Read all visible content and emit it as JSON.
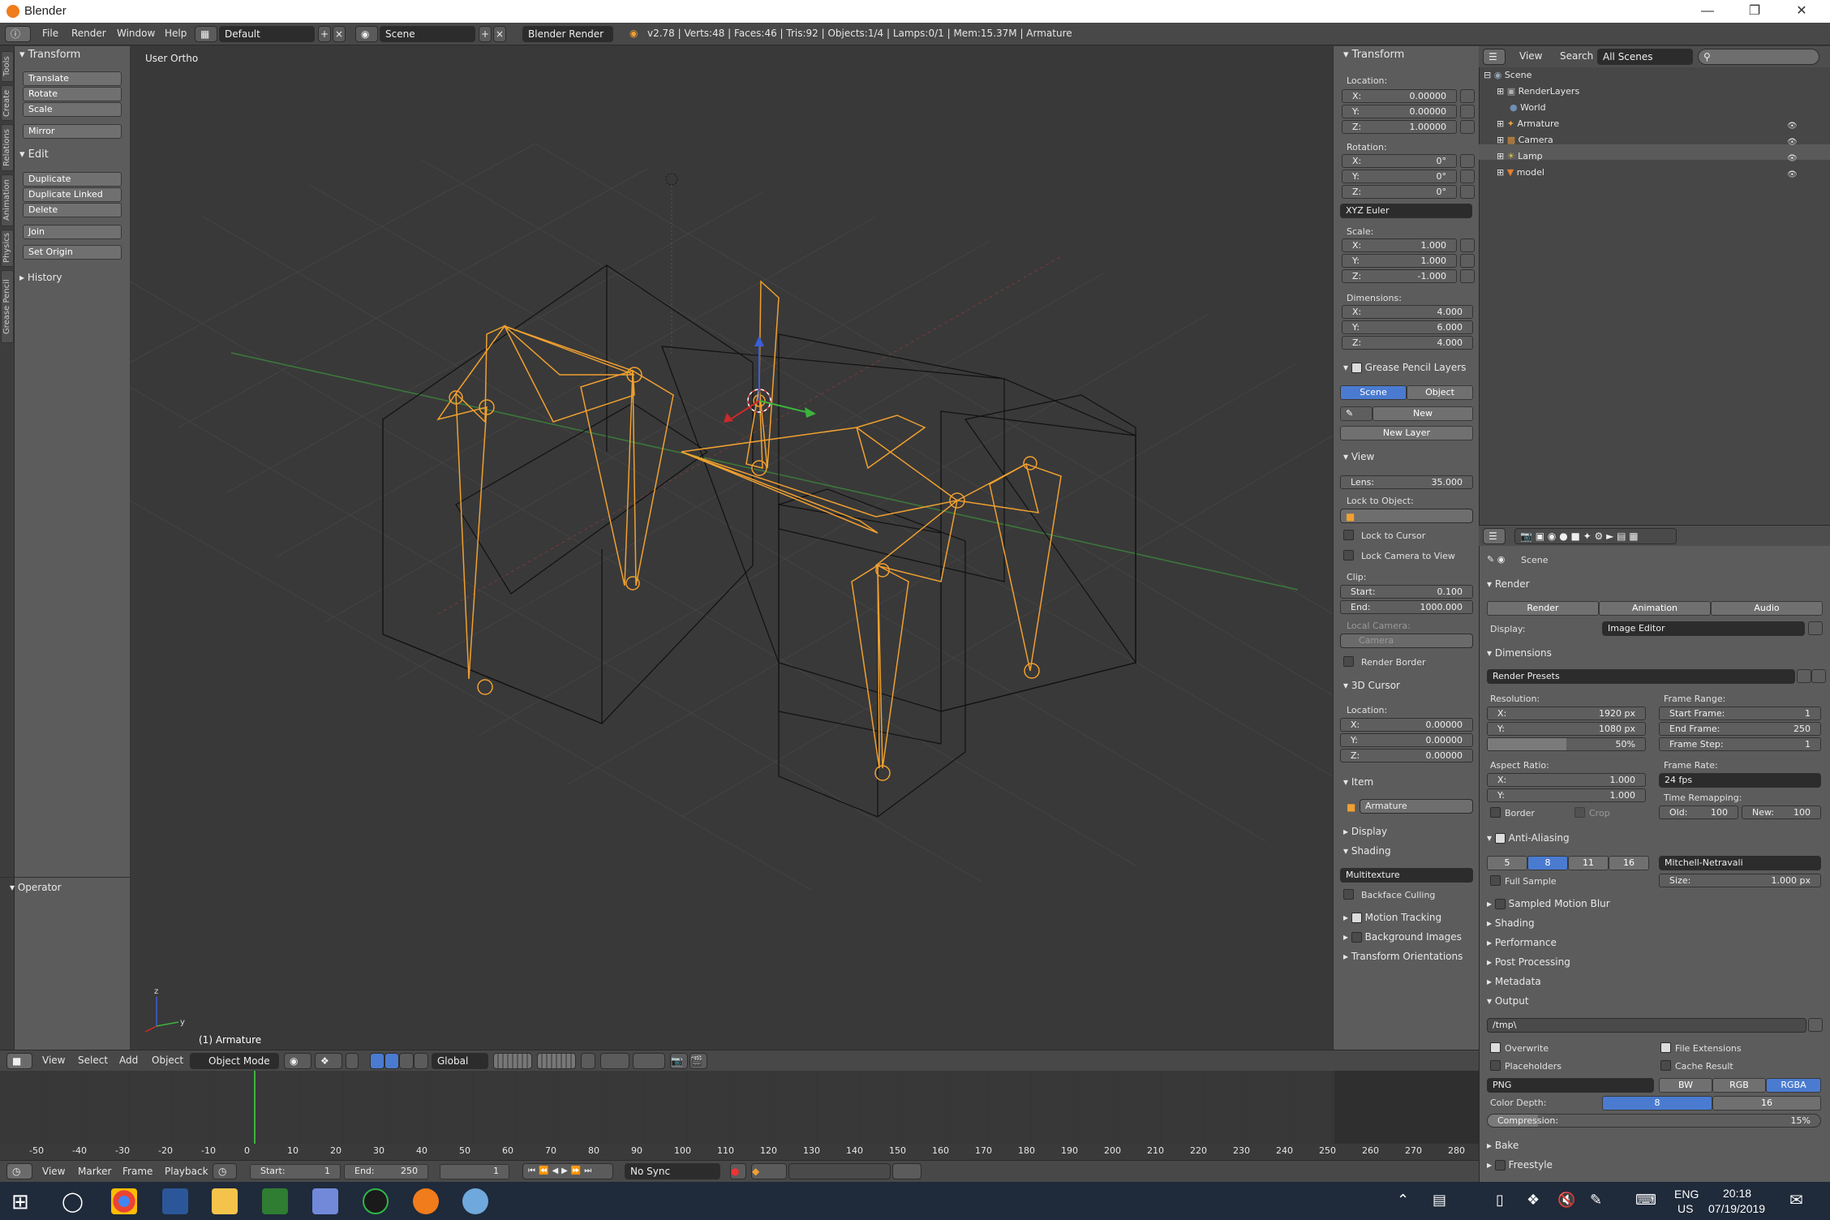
{
  "window": {
    "title": "Blender"
  },
  "info_header": {
    "menus": [
      "File",
      "Render",
      "Window",
      "Help"
    ],
    "layout": "Default",
    "scene": "Scene",
    "engine": "Blender Render",
    "stats": "v2.78 | Verts:48 | Faces:46 | Tris:92 | Objects:1/4 | Lamps:0/1 | Mem:15.37M | Armature"
  },
  "tool_tabs": [
    "Tools",
    "Create",
    "Relations",
    "Animation",
    "Physics",
    "Grease Pencil"
  ],
  "tool_shelf": {
    "transform_title": "Transform",
    "transform_buttons": [
      "Translate",
      "Rotate",
      "Scale"
    ],
    "mirror": "Mirror",
    "edit_title": "Edit",
    "edit_buttons": [
      "Duplicate",
      "Duplicate Linked",
      "Delete"
    ],
    "join": "Join",
    "set_origin": "Set Origin",
    "history": "History",
    "operator": "Operator"
  },
  "viewport": {
    "view_name": "User Ortho",
    "object_label": "(1) Armature"
  },
  "n_panel": {
    "transform": "Transform",
    "location_label": "Location:",
    "location": [
      {
        "k": "X:",
        "v": "0.00000"
      },
      {
        "k": "Y:",
        "v": "0.00000"
      },
      {
        "k": "Z:",
        "v": "1.00000"
      }
    ],
    "rotation_label": "Rotation:",
    "rotation": [
      {
        "k": "X:",
        "v": "0°"
      },
      {
        "k": "Y:",
        "v": "0°"
      },
      {
        "k": "Z:",
        "v": "0°"
      }
    ],
    "rotation_mode": "XYZ Euler",
    "scale_label": "Scale:",
    "scale": [
      {
        "k": "X:",
        "v": "1.000"
      },
      {
        "k": "Y:",
        "v": "1.000"
      },
      {
        "k": "Z:",
        "v": "-1.000"
      }
    ],
    "dimensions_label": "Dimensions:",
    "dimensions": [
      {
        "k": "X:",
        "v": "4.000"
      },
      {
        "k": "Y:",
        "v": "6.000"
      },
      {
        "k": "Z:",
        "v": "4.000"
      }
    ],
    "grease_pencil": "Grease Pencil Layers",
    "gp_scene": "Scene",
    "gp_object": "Object",
    "gp_new": "New",
    "gp_new_layer": "New Layer",
    "view": "View",
    "lens_k": "Lens:",
    "lens_v": "35.000",
    "lock_to_object": "Lock to Object:",
    "lock_to_cursor": "Lock to Cursor",
    "lock_camera": "Lock Camera to View",
    "clip": "Clip:",
    "clip_start_k": "Start:",
    "clip_start_v": "0.100",
    "clip_end_k": "End:",
    "clip_end_v": "1000.000",
    "local_camera": "Local Camera:",
    "camera": "Camera",
    "render_border": "Render Border",
    "cursor": "3D Cursor",
    "cursor_location": "Location:",
    "cursor_loc": [
      {
        "k": "X:",
        "v": "0.00000"
      },
      {
        "k": "Y:",
        "v": "0.00000"
      },
      {
        "k": "Z:",
        "v": "0.00000"
      }
    ],
    "item": "Item",
    "item_name": "Armature",
    "display": "Display",
    "shading": "Shading",
    "shading_mode": "Multitexture",
    "backface": "Backface Culling",
    "motion_tracking": "Motion Tracking",
    "background_images": "Background Images",
    "transform_orientations": "Transform Orientations"
  },
  "outliner": {
    "view": "View",
    "search": "Search",
    "scenes": "All Scenes",
    "items": [
      {
        "label": "Scene",
        "color": "#9aa6b8"
      },
      {
        "label": "RenderLayers",
        "color": "#b0b0b0"
      },
      {
        "label": "World",
        "color": "#6f8fb5"
      },
      {
        "label": "Armature",
        "color": "#e8a040"
      },
      {
        "label": "Camera",
        "color": "#d88f3b"
      },
      {
        "label": "Lamp",
        "color": "#d6c04a"
      },
      {
        "label": "model",
        "color": "#e27c2f"
      }
    ]
  },
  "properties": {
    "scene": "Scene",
    "render": "Render",
    "render_btn": "Render",
    "animation_btn": "Animation",
    "audio_btn": "Audio",
    "display_k": "Display:",
    "display_v": "Image Editor",
    "dimensions": "Dimensions",
    "render_presets": "Render Presets",
    "resolution": "Resolution:",
    "res_x_k": "X:",
    "res_x_v": "1920 px",
    "res_y_k": "Y:",
    "res_y_v": "1080 px",
    "res_pct": "50%",
    "res_pct_value": 0.5,
    "frame_range": "Frame Range:",
    "start_frame_k": "Start Frame:",
    "start_frame_v": "1",
    "end_frame_k": "End Frame:",
    "end_frame_v": "250",
    "frame_step_k": "Frame Step:",
    "frame_step_v": "1",
    "aspect": "Aspect Ratio:",
    "asp_x_k": "X:",
    "asp_x_v": "1.000",
    "asp_y_k": "Y:",
    "asp_y_v": "1.000",
    "frame_rate": "Frame Rate:",
    "fps": "24 fps",
    "time_remap": "Time Remapping:",
    "old_k": "Old:",
    "old_v": "100",
    "new_k": "New:",
    "new_v": "100",
    "border": "Border",
    "crop": "Crop",
    "anti_aliasing": "Anti-Aliasing",
    "aa_samples": [
      "5",
      "8",
      "11",
      "16"
    ],
    "aa_filter": "Mitchell-Netravali",
    "full_sample": "Full Sample",
    "size_k": "Size:",
    "size_v": "1.000 px",
    "sampled_motion_blur": "Sampled Motion Blur",
    "shading": "Shading",
    "performance": "Performance",
    "post_processing": "Post Processing",
    "metadata": "Metadata",
    "output": "Output",
    "output_path": "/tmp\\",
    "overwrite": "Overwrite",
    "file_extensions": "File Extensions",
    "placeholders": "Placeholders",
    "cache_result": "Cache Result",
    "format": "PNG",
    "bw": "BW",
    "rgb": "RGB",
    "rgba": "RGBA",
    "color_depth_k": "Color Depth:",
    "depth_8": "8",
    "depth_16": "16",
    "compression_k": "Compression:",
    "compression_v": "15%",
    "compression_value": 0.15,
    "bake": "Bake",
    "freestyle": "Freestyle"
  },
  "view3d_header": {
    "menus": [
      "View",
      "Select",
      "Add",
      "Object"
    ],
    "mode": "Object Mode",
    "orientation": "Global"
  },
  "timeline": {
    "ticks": [
      "-50",
      "-40",
      "-30",
      "-20",
      "-10",
      "0",
      "10",
      "20",
      "30",
      "40",
      "50",
      "60",
      "70",
      "80",
      "90",
      "100",
      "110",
      "120",
      "130",
      "140",
      "150",
      "160",
      "170",
      "180",
      "190",
      "200",
      "210",
      "220",
      "230",
      "240",
      "250",
      "260",
      "270",
      "280"
    ],
    "menus": [
      "View",
      "Marker",
      "Frame",
      "Playback"
    ],
    "start_k": "Start:",
    "start_v": "1",
    "end_k": "End:",
    "end_v": "250",
    "current": "1",
    "sync": "No Sync"
  },
  "taskbar": {
    "lang": "ENG",
    "region": "US",
    "time": "20:18",
    "date": "07/19/2019"
  }
}
